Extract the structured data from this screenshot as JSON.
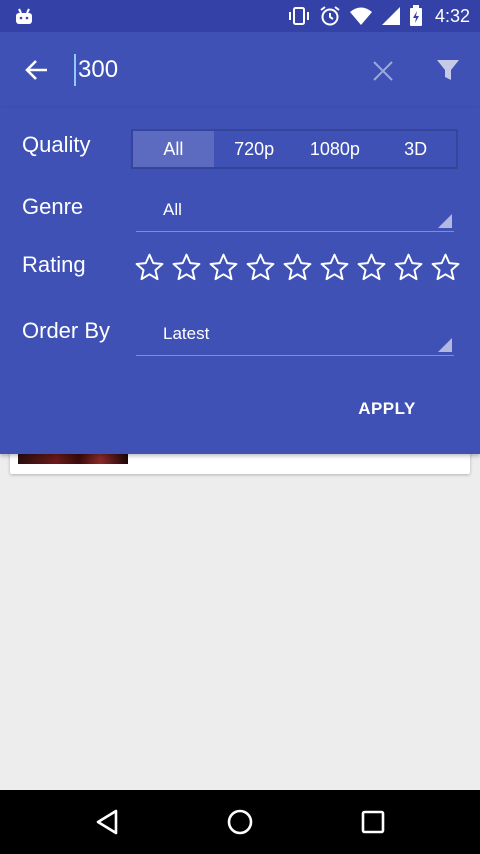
{
  "status_bar": {
    "time": "4:32",
    "icons": [
      "android-icon",
      "vibrate-icon",
      "alarm-icon",
      "wifi-icon",
      "signal-icon",
      "battery-icon"
    ]
  },
  "toolbar": {
    "search_value": "300",
    "icons": [
      "back-arrow-icon",
      "clear-icon",
      "filter-icon"
    ]
  },
  "filters": {
    "quality": {
      "label": "Quality",
      "options": [
        "All",
        "720p",
        "1080p",
        "3D"
      ],
      "selected": "All"
    },
    "genre": {
      "label": "Genre",
      "value": "All"
    },
    "rating": {
      "label": "Rating",
      "max_stars": 9,
      "selected_stars": 0
    },
    "order_by": {
      "label": "Order By",
      "value": "Latest"
    },
    "apply_label": "APPLY"
  },
  "colors": {
    "primary": "#3f51b5",
    "primary_dark": "#3442a8",
    "segment_selected": "#5c6bc0",
    "background": "#ededed"
  },
  "nav_bar": {
    "icons": [
      "nav-back-icon",
      "nav-home-icon",
      "nav-recents-icon"
    ]
  }
}
